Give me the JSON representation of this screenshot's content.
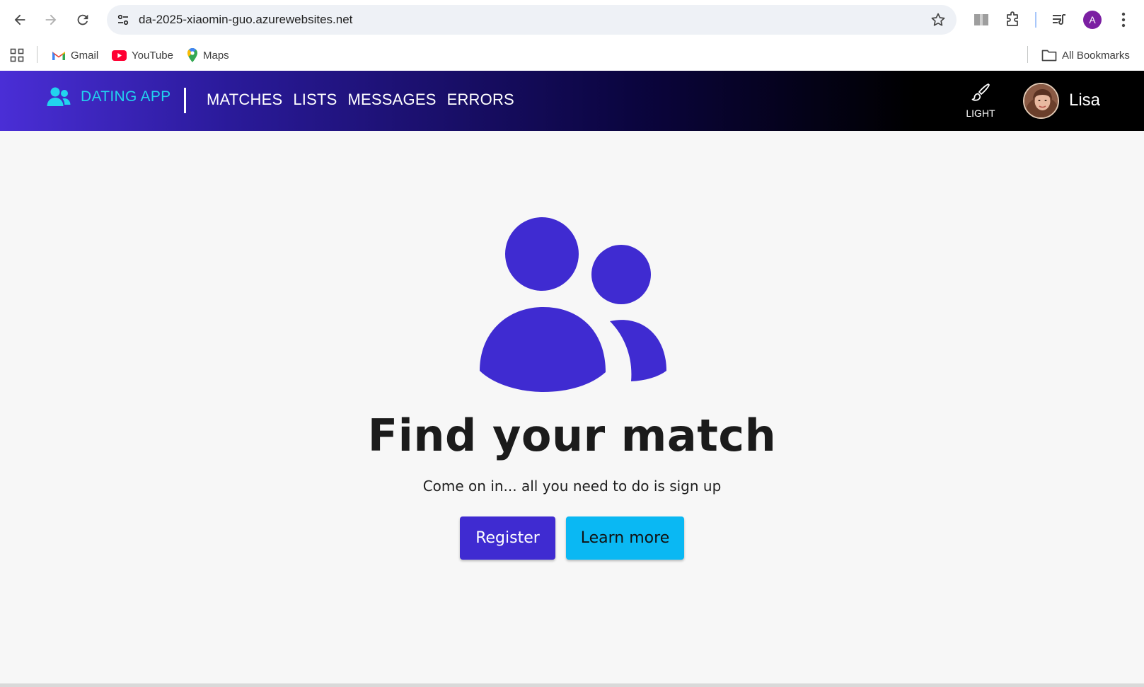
{
  "browser": {
    "url": "da-2025-xiaomin-guo.azurewebsites.net",
    "profile_initial": "A",
    "bookmarks": [
      {
        "label": "Gmail",
        "icon": "gmail-icon"
      },
      {
        "label": "YouTube",
        "icon": "youtube-icon"
      },
      {
        "label": "Maps",
        "icon": "maps-icon"
      }
    ],
    "all_bookmarks_label": "All Bookmarks"
  },
  "app": {
    "brand": "DATING APP",
    "nav": [
      "MATCHES",
      "LISTS",
      "MESSAGES",
      "ERRORS"
    ],
    "theme_label": "LIGHT",
    "user_name": "Lisa",
    "colors": {
      "brand_text": "#22d3ee",
      "primary": "#3f2bd1",
      "info": "#0ab8f3"
    }
  },
  "hero": {
    "title": "Find your match",
    "subtitle": "Come on in... all you need to do is sign up",
    "register_label": "Register",
    "learn_more_label": "Learn more"
  }
}
